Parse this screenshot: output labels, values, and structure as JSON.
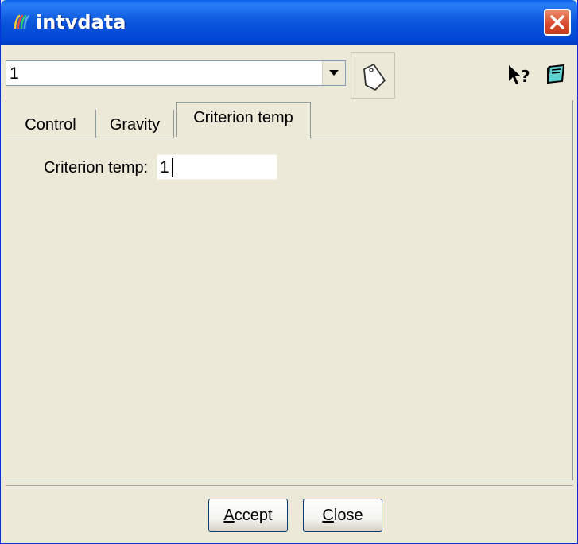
{
  "window": {
    "title": "intvdata",
    "app_icon": "app-logo-icon",
    "close_icon": "close-icon"
  },
  "toolbar": {
    "combo_value": "1",
    "dropdown_icon": "chevron-down-icon",
    "tag_icon": "tag-icon",
    "help_icon": "whats-this-help-icon",
    "book_icon": "book-icon"
  },
  "tabs": [
    {
      "label": "Control"
    },
    {
      "label": "Gravity"
    },
    {
      "label": "Criterion temp",
      "active": true
    }
  ],
  "criterion": {
    "label": "Criterion temp:",
    "value": "1"
  },
  "buttons": {
    "accept_first": "A",
    "accept_rest": "ccept",
    "close_first": "C",
    "close_rest": "lose"
  },
  "colors": {
    "titlebar": "#0b56dc",
    "face": "#ece9d8",
    "close": "#d8492b"
  }
}
